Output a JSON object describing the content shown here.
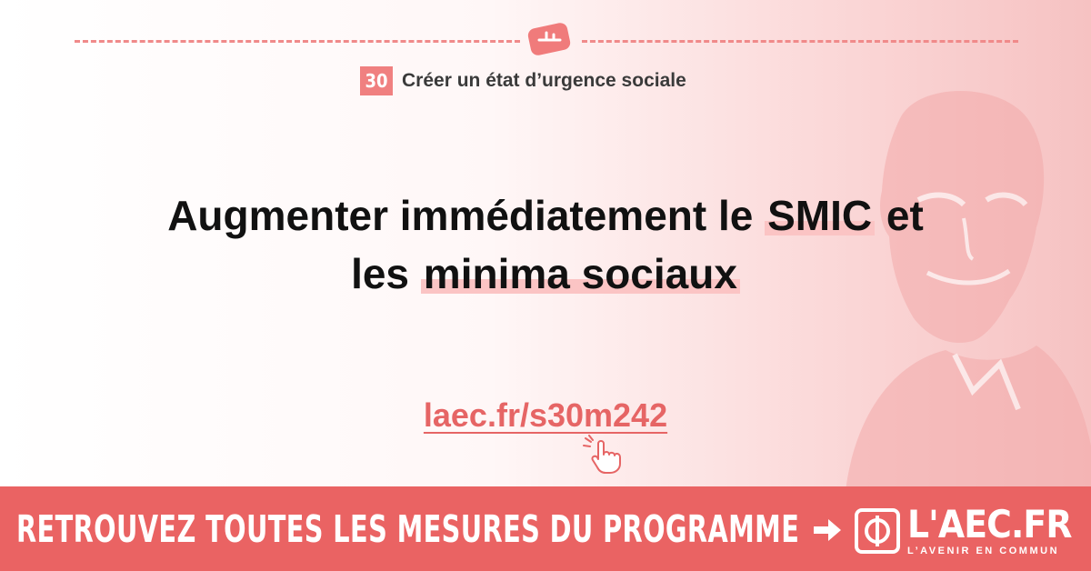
{
  "section": {
    "number": "30",
    "title": "Créer un état d’urgence sociale"
  },
  "headline": {
    "line1_before": "Augmenter immédiatement le ",
    "line1_highlight": "SMIC",
    "line1_after": " et",
    "line2_before": "les ",
    "line2_highlight": "minima sociaux"
  },
  "link": {
    "text": "laec.fr/s30m242"
  },
  "banner": {
    "text": "RETROUVEZ TOUTES LES MESURES DU PROGRAMME",
    "brand_name": "L'AEC.FR",
    "brand_tagline": "L’AVENIR EN COMMUN"
  },
  "colors": {
    "accent": "#ea6363",
    "highlight": "#fbc4c4",
    "link": "#e66565"
  },
  "icons": [
    "handshake-icon",
    "pointer-hand-icon",
    "arrow-right-icon",
    "phi-logo-icon",
    "portrait-illustration"
  ]
}
